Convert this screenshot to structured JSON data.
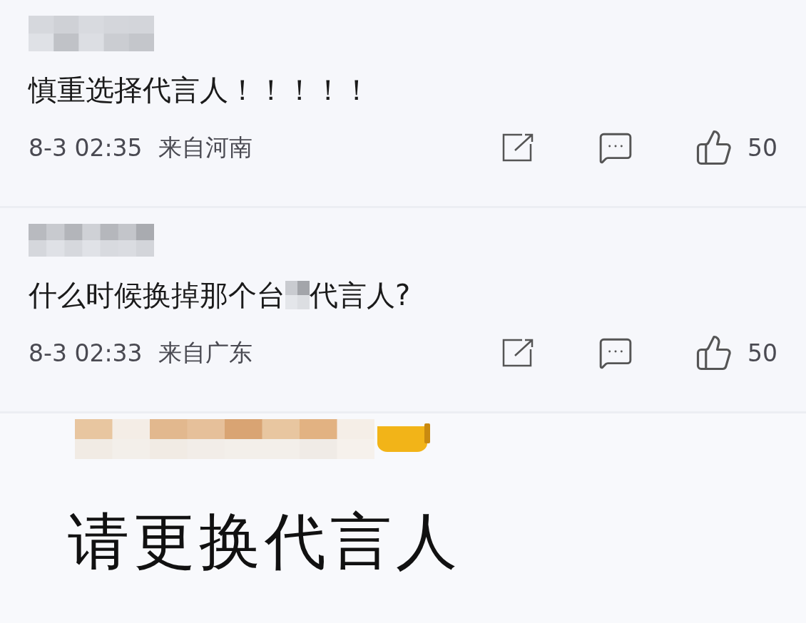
{
  "comments": [
    {
      "kind": "meta",
      "text": "慎重选择代言人！！！！！",
      "time": "8-3 02:35",
      "location": "来自河南",
      "likes": "50"
    },
    {
      "kind": "meta",
      "text": "什么时候换掉那个台",
      "text_after": "代言人?",
      "time": "8-3 02:33",
      "location": "来自广东",
      "likes": "50"
    },
    {
      "kind": "large",
      "text": "请更换代言人"
    }
  ]
}
